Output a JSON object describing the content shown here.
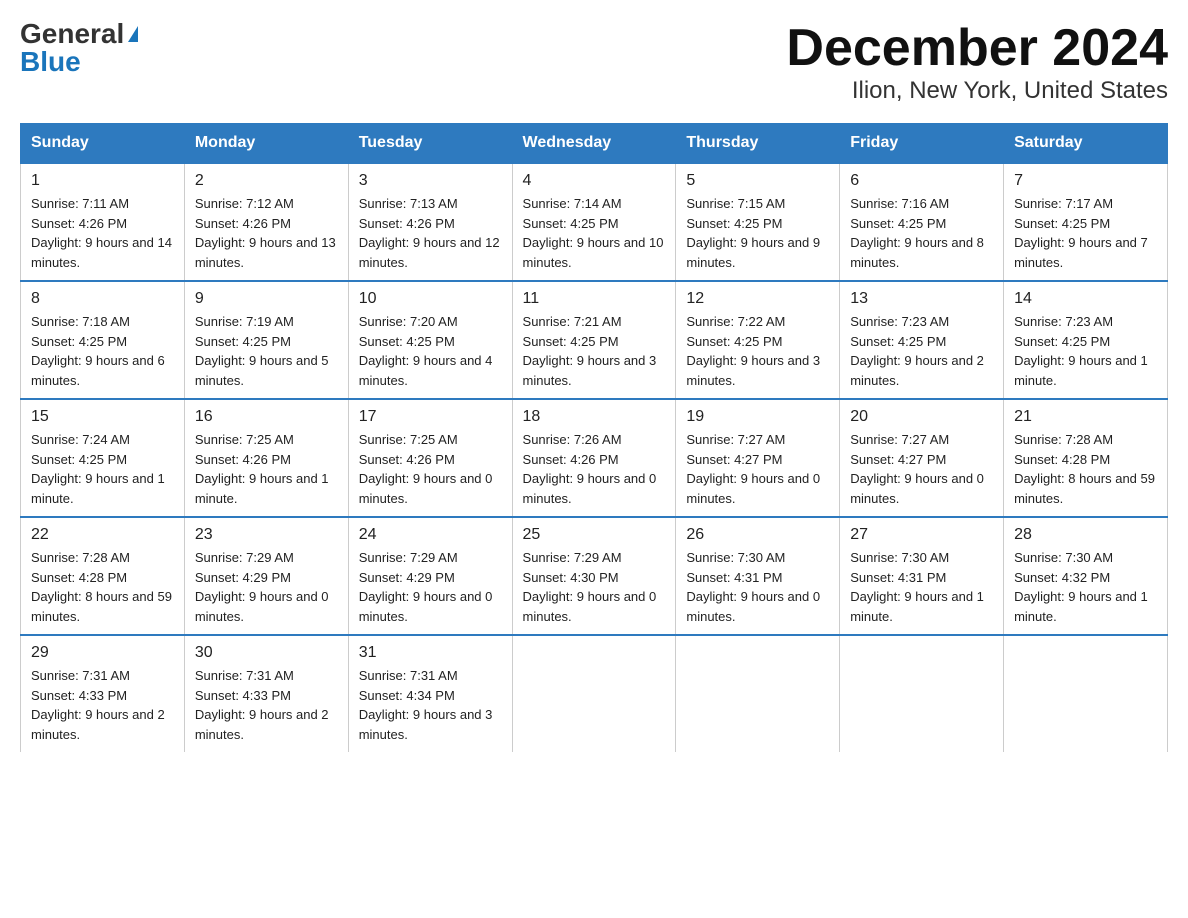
{
  "logo": {
    "general": "General",
    "blue": "Blue"
  },
  "title": "December 2024",
  "subtitle": "Ilion, New York, United States",
  "days_header": [
    "Sunday",
    "Monday",
    "Tuesday",
    "Wednesday",
    "Thursday",
    "Friday",
    "Saturday"
  ],
  "weeks": [
    [
      {
        "day": "1",
        "sunrise": "7:11 AM",
        "sunset": "4:26 PM",
        "daylight": "9 hours and 14 minutes."
      },
      {
        "day": "2",
        "sunrise": "7:12 AM",
        "sunset": "4:26 PM",
        "daylight": "9 hours and 13 minutes."
      },
      {
        "day": "3",
        "sunrise": "7:13 AM",
        "sunset": "4:26 PM",
        "daylight": "9 hours and 12 minutes."
      },
      {
        "day": "4",
        "sunrise": "7:14 AM",
        "sunset": "4:25 PM",
        "daylight": "9 hours and 10 minutes."
      },
      {
        "day": "5",
        "sunrise": "7:15 AM",
        "sunset": "4:25 PM",
        "daylight": "9 hours and 9 minutes."
      },
      {
        "day": "6",
        "sunrise": "7:16 AM",
        "sunset": "4:25 PM",
        "daylight": "9 hours and 8 minutes."
      },
      {
        "day": "7",
        "sunrise": "7:17 AM",
        "sunset": "4:25 PM",
        "daylight": "9 hours and 7 minutes."
      }
    ],
    [
      {
        "day": "8",
        "sunrise": "7:18 AM",
        "sunset": "4:25 PM",
        "daylight": "9 hours and 6 minutes."
      },
      {
        "day": "9",
        "sunrise": "7:19 AM",
        "sunset": "4:25 PM",
        "daylight": "9 hours and 5 minutes."
      },
      {
        "day": "10",
        "sunrise": "7:20 AM",
        "sunset": "4:25 PM",
        "daylight": "9 hours and 4 minutes."
      },
      {
        "day": "11",
        "sunrise": "7:21 AM",
        "sunset": "4:25 PM",
        "daylight": "9 hours and 3 minutes."
      },
      {
        "day": "12",
        "sunrise": "7:22 AM",
        "sunset": "4:25 PM",
        "daylight": "9 hours and 3 minutes."
      },
      {
        "day": "13",
        "sunrise": "7:23 AM",
        "sunset": "4:25 PM",
        "daylight": "9 hours and 2 minutes."
      },
      {
        "day": "14",
        "sunrise": "7:23 AM",
        "sunset": "4:25 PM",
        "daylight": "9 hours and 1 minute."
      }
    ],
    [
      {
        "day": "15",
        "sunrise": "7:24 AM",
        "sunset": "4:25 PM",
        "daylight": "9 hours and 1 minute."
      },
      {
        "day": "16",
        "sunrise": "7:25 AM",
        "sunset": "4:26 PM",
        "daylight": "9 hours and 1 minute."
      },
      {
        "day": "17",
        "sunrise": "7:25 AM",
        "sunset": "4:26 PM",
        "daylight": "9 hours and 0 minutes."
      },
      {
        "day": "18",
        "sunrise": "7:26 AM",
        "sunset": "4:26 PM",
        "daylight": "9 hours and 0 minutes."
      },
      {
        "day": "19",
        "sunrise": "7:27 AM",
        "sunset": "4:27 PM",
        "daylight": "9 hours and 0 minutes."
      },
      {
        "day": "20",
        "sunrise": "7:27 AM",
        "sunset": "4:27 PM",
        "daylight": "9 hours and 0 minutes."
      },
      {
        "day": "21",
        "sunrise": "7:28 AM",
        "sunset": "4:28 PM",
        "daylight": "8 hours and 59 minutes."
      }
    ],
    [
      {
        "day": "22",
        "sunrise": "7:28 AM",
        "sunset": "4:28 PM",
        "daylight": "8 hours and 59 minutes."
      },
      {
        "day": "23",
        "sunrise": "7:29 AM",
        "sunset": "4:29 PM",
        "daylight": "9 hours and 0 minutes."
      },
      {
        "day": "24",
        "sunrise": "7:29 AM",
        "sunset": "4:29 PM",
        "daylight": "9 hours and 0 minutes."
      },
      {
        "day": "25",
        "sunrise": "7:29 AM",
        "sunset": "4:30 PM",
        "daylight": "9 hours and 0 minutes."
      },
      {
        "day": "26",
        "sunrise": "7:30 AM",
        "sunset": "4:31 PM",
        "daylight": "9 hours and 0 minutes."
      },
      {
        "day": "27",
        "sunrise": "7:30 AM",
        "sunset": "4:31 PM",
        "daylight": "9 hours and 1 minute."
      },
      {
        "day": "28",
        "sunrise": "7:30 AM",
        "sunset": "4:32 PM",
        "daylight": "9 hours and 1 minute."
      }
    ],
    [
      {
        "day": "29",
        "sunrise": "7:31 AM",
        "sunset": "4:33 PM",
        "daylight": "9 hours and 2 minutes."
      },
      {
        "day": "30",
        "sunrise": "7:31 AM",
        "sunset": "4:33 PM",
        "daylight": "9 hours and 2 minutes."
      },
      {
        "day": "31",
        "sunrise": "7:31 AM",
        "sunset": "4:34 PM",
        "daylight": "9 hours and 3 minutes."
      },
      null,
      null,
      null,
      null
    ]
  ]
}
